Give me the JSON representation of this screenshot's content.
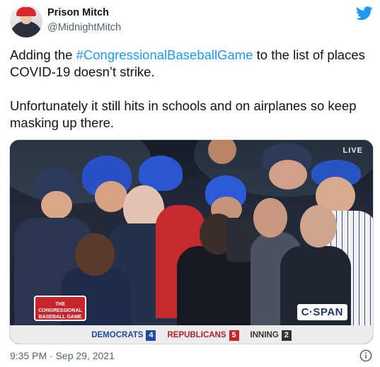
{
  "user": {
    "display_name": "Prison Mitch",
    "handle": "@MidnightMitch"
  },
  "tweet": {
    "text_before_hashtag": "Adding the ",
    "hashtag": "#CongressionalBaseballGame",
    "text_after_hashtag": " to the list of places COVID-19 doesn’t strike.",
    "paragraph2": "Unfortunately it still hits in schools and on airplanes so keep masking up there.",
    "timestamp": "9:35 PM · Sep 29, 2021"
  },
  "media": {
    "live_label": "LIVE",
    "logo_badge_text": "THE CONGRESSIONAL BASEBALL GAME",
    "network_label": "C·SPAN",
    "scoreboard": [
      {
        "team": "DEMOCRATS",
        "score": "4"
      },
      {
        "team": "REPUBLICANS",
        "score": "5"
      },
      {
        "team": "INNING",
        "score": "2"
      }
    ]
  },
  "icons": {
    "brand": "twitter-bird-icon",
    "info": "info-icon"
  },
  "colors": {
    "accent": "#1d9bf0",
    "text": "#0f1419",
    "muted": "#536471",
    "democrats": "#1f4aa0",
    "republicans": "#c8242b"
  }
}
